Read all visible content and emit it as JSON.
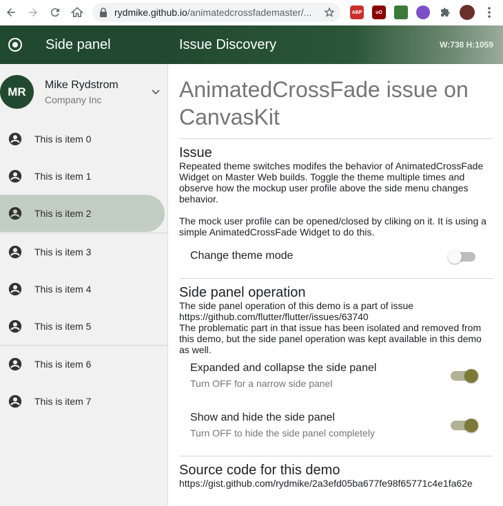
{
  "browser": {
    "url_host": "rydmike.github.io",
    "url_path": "/animatedcrossfademaster/..."
  },
  "appbar": {
    "side_title": "Side panel",
    "main_title": "Issue Discovery",
    "size_readout": "W:738 H:1059"
  },
  "profile": {
    "initials": "MR",
    "name": "Mike Rydstrom",
    "company": "Company Inc"
  },
  "menu": {
    "items": [
      {
        "label": "This is item 0"
      },
      {
        "label": "This is item 1"
      },
      {
        "label": "This is item 2"
      },
      {
        "label": "This is item 3"
      },
      {
        "label": "This is item 4"
      },
      {
        "label": "This is item 5"
      },
      {
        "label": "This is item 6"
      },
      {
        "label": "This is item 7"
      }
    ],
    "selected_index": 2
  },
  "content": {
    "title": "AnimatedCrossFade issue on CanvasKit",
    "issue": {
      "heading": "Issue",
      "para1": "Repeated theme switches modifes the behavior of AnimatedCrossFade Widget on Master Web builds. Toggle the theme multiple times and observe how the mockup user profile above the side menu changes behavior.",
      "para2": "The mock user profile can be opened/closed by cliking on it. It is using a simple AnimatedCrossFade Widget to do this.",
      "theme_label": "Change theme mode",
      "theme_on": false
    },
    "side_op": {
      "heading": "Side panel operation",
      "para1": "The side panel operation of this demo is a part of issue https://github.com/flutter/flutter/issues/63740",
      "para2": "The problematic part in that issue has been isolated and removed from this demo, but the side panel operation was kept available in this demo as well.",
      "expand_title": "Expanded and collapse the side panel",
      "expand_sub": "Turn OFF for a narrow side panel",
      "expand_on": true,
      "show_title": "Show and hide the side panel",
      "show_sub": "Turn OFF to hide the side panel completely",
      "show_on": true
    },
    "source": {
      "heading": "Source code for this demo",
      "link": "https://gist.github.com/rydmike/2a3efd05ba677fe98f65771c4e1fa62e"
    }
  },
  "colors": {
    "primary": "#21492f",
    "selected_item": "#c3cec3",
    "switch_active": "#7d7a39"
  }
}
